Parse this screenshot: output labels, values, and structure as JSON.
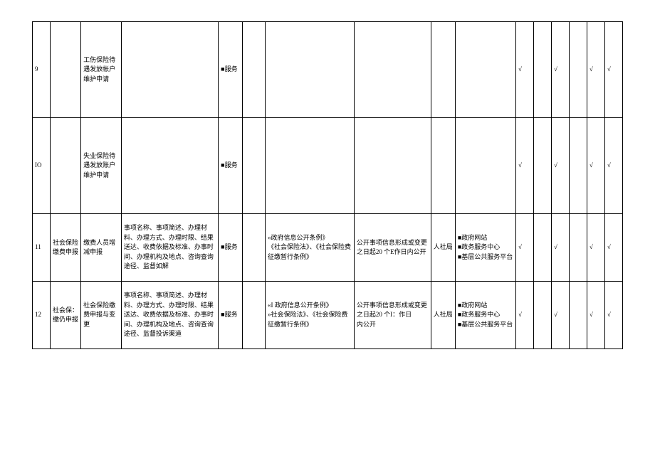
{
  "rows": [
    {
      "num": "9",
      "cat": "",
      "item": "工伤保险待遇发放帐户维护申请",
      "desc": "",
      "type": "■服务",
      "blank1": "",
      "basis": "",
      "timing": "",
      "dept": "",
      "channel": "",
      "checks": [
        "√",
        "",
        "√",
        "",
        "√",
        "√"
      ]
    },
    {
      "num": "IO",
      "cat": "",
      "item": "失业保险待遇发放账户维护申请",
      "desc": "",
      "type": "■服务",
      "blank1": "",
      "basis": "",
      "timing": "",
      "dept": "",
      "channel": "",
      "checks": [
        "√",
        "",
        "√",
        "",
        "√",
        "√"
      ]
    },
    {
      "num": "11",
      "cat": "社会保险缴费申报",
      "item": "缴费人员增减申报",
      "desc": "事项名称、事项简述、办理材料、办理方式、办理时限、结果送达、收费依据及标准、办事时间、办理机构及地点、咨询查询途径、监督如解",
      "type": "■服务",
      "blank1": "",
      "basis": "«政府信息公开条例》\n《社会保险法》、《社会保险费征缴暂行条例》",
      "timing": "公开事项信息形成或变更之日起20 个E作日内公开",
      "dept": "人社局",
      "channel": "■政府网站\n■政务服务中心\n■基层公共服务平台",
      "checks": [
        "√",
        "",
        "√",
        "",
        "√",
        "√"
      ]
    },
    {
      "num": "12",
      "cat": "社会保：缴仍申报",
      "item": "社会保险缴费申报与变更",
      "desc": "事项名称、事项简述、办理材料、办理方式、办理时限、结果送达、收费依据及标准、办事时间、办理机构及地点、咨询查询途径、监督投诉渠道",
      "type": "■服务",
      "blank1": "",
      "basis": "«I 政府信息公开条例》\n»社会保险法》、《社会保险费征缴暂行条例》",
      "timing": "公开事项信息形成或变更之日起20 个I：作日\n内公开",
      "dept": "人社局",
      "channel": "■政府网站\n■政务服务中心\n■基层公共服务平台",
      "checks": [
        "√",
        "",
        "√",
        "",
        "√",
        "√"
      ]
    }
  ]
}
